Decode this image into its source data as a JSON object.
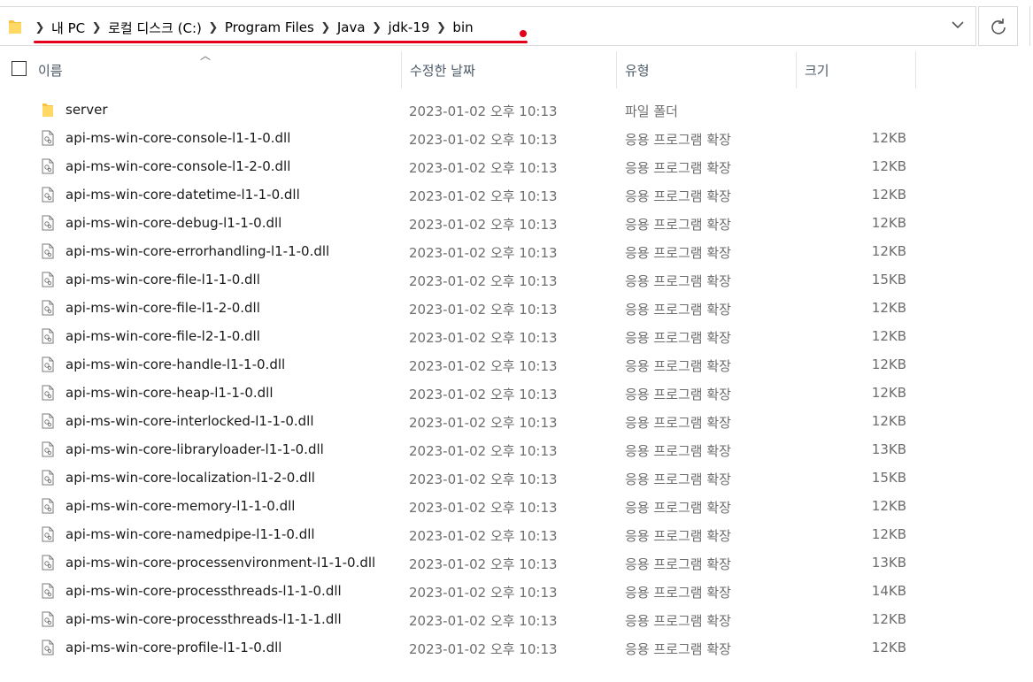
{
  "breadcrumb": [
    "내 PC",
    "로컬 디스크 (C:)",
    "Program Files",
    "Java",
    "jdk-19",
    "bin"
  ],
  "columns": {
    "name": "이름",
    "date": "수정한 날짜",
    "type": "유형",
    "size": "크기"
  },
  "colors": {
    "annotation_red": "#e2001a",
    "folder_yellow": "#f5c242"
  },
  "rows": [
    {
      "icon": "folder-icon",
      "name": "server",
      "date": "2023-01-02 오후 10:13",
      "type": "파일 폴더",
      "size": ""
    },
    {
      "icon": "dll-file-icon",
      "name": "api-ms-win-core-console-l1-1-0.dll",
      "date": "2023-01-02 오후 10:13",
      "type": "응용 프로그램 확장",
      "size": "12KB"
    },
    {
      "icon": "dll-file-icon",
      "name": "api-ms-win-core-console-l1-2-0.dll",
      "date": "2023-01-02 오후 10:13",
      "type": "응용 프로그램 확장",
      "size": "12KB"
    },
    {
      "icon": "dll-file-icon",
      "name": "api-ms-win-core-datetime-l1-1-0.dll",
      "date": "2023-01-02 오후 10:13",
      "type": "응용 프로그램 확장",
      "size": "12KB"
    },
    {
      "icon": "dll-file-icon",
      "name": "api-ms-win-core-debug-l1-1-0.dll",
      "date": "2023-01-02 오후 10:13",
      "type": "응용 프로그램 확장",
      "size": "12KB"
    },
    {
      "icon": "dll-file-icon",
      "name": "api-ms-win-core-errorhandling-l1-1-0.dll",
      "date": "2023-01-02 오후 10:13",
      "type": "응용 프로그램 확장",
      "size": "12KB"
    },
    {
      "icon": "dll-file-icon",
      "name": "api-ms-win-core-file-l1-1-0.dll",
      "date": "2023-01-02 오후 10:13",
      "type": "응용 프로그램 확장",
      "size": "15KB"
    },
    {
      "icon": "dll-file-icon",
      "name": "api-ms-win-core-file-l1-2-0.dll",
      "date": "2023-01-02 오후 10:13",
      "type": "응용 프로그램 확장",
      "size": "12KB"
    },
    {
      "icon": "dll-file-icon",
      "name": "api-ms-win-core-file-l2-1-0.dll",
      "date": "2023-01-02 오후 10:13",
      "type": "응용 프로그램 확장",
      "size": "12KB"
    },
    {
      "icon": "dll-file-icon",
      "name": "api-ms-win-core-handle-l1-1-0.dll",
      "date": "2023-01-02 오후 10:13",
      "type": "응용 프로그램 확장",
      "size": "12KB"
    },
    {
      "icon": "dll-file-icon",
      "name": "api-ms-win-core-heap-l1-1-0.dll",
      "date": "2023-01-02 오후 10:13",
      "type": "응용 프로그램 확장",
      "size": "12KB"
    },
    {
      "icon": "dll-file-icon",
      "name": "api-ms-win-core-interlocked-l1-1-0.dll",
      "date": "2023-01-02 오후 10:13",
      "type": "응용 프로그램 확장",
      "size": "12KB"
    },
    {
      "icon": "dll-file-icon",
      "name": "api-ms-win-core-libraryloader-l1-1-0.dll",
      "date": "2023-01-02 오후 10:13",
      "type": "응용 프로그램 확장",
      "size": "13KB"
    },
    {
      "icon": "dll-file-icon",
      "name": "api-ms-win-core-localization-l1-2-0.dll",
      "date": "2023-01-02 오후 10:13",
      "type": "응용 프로그램 확장",
      "size": "15KB"
    },
    {
      "icon": "dll-file-icon",
      "name": "api-ms-win-core-memory-l1-1-0.dll",
      "date": "2023-01-02 오후 10:13",
      "type": "응용 프로그램 확장",
      "size": "12KB"
    },
    {
      "icon": "dll-file-icon",
      "name": "api-ms-win-core-namedpipe-l1-1-0.dll",
      "date": "2023-01-02 오후 10:13",
      "type": "응용 프로그램 확장",
      "size": "12KB"
    },
    {
      "icon": "dll-file-icon",
      "name": "api-ms-win-core-processenvironment-l1-1-0.dll",
      "date": "2023-01-02 오후 10:13",
      "type": "응용 프로그램 확장",
      "size": "13KB"
    },
    {
      "icon": "dll-file-icon",
      "name": "api-ms-win-core-processthreads-l1-1-0.dll",
      "date": "2023-01-02 오후 10:13",
      "type": "응용 프로그램 확장",
      "size": "14KB"
    },
    {
      "icon": "dll-file-icon",
      "name": "api-ms-win-core-processthreads-l1-1-1.dll",
      "date": "2023-01-02 오후 10:13",
      "type": "응용 프로그램 확장",
      "size": "12KB"
    },
    {
      "icon": "dll-file-icon",
      "name": "api-ms-win-core-profile-l1-1-0.dll",
      "date": "2023-01-02 오후 10:13",
      "type": "응용 프로그램 확장",
      "size": "12KB"
    }
  ]
}
